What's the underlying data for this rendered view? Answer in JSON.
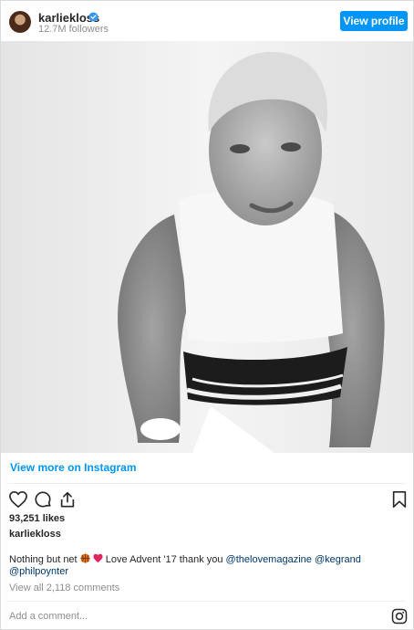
{
  "header": {
    "username": "karliekloss",
    "followers": "12.7M followers",
    "view_profile_label": "View profile",
    "verified_color": "#3897f0"
  },
  "media": {
    "description_icon": "photo",
    "tone": "black-and-white"
  },
  "links": {
    "view_more_label": "View more on Instagram"
  },
  "actions": {
    "icons": [
      "heart-icon",
      "comment-icon",
      "share-icon",
      "bookmark-icon"
    ]
  },
  "post": {
    "likes": "93,251 likes",
    "author": "karliekloss",
    "caption_text_1": "Nothing but net ",
    "caption_text_2": " Love Advent '17 thank you ",
    "mention_1": "@thelovemagazine",
    "mention_2": "@kegrand",
    "mention_3": "@philpoynter",
    "view_all_comments": "View all 2,118 comments"
  },
  "comment_box": {
    "placeholder": "Add a comment..."
  },
  "colors": {
    "accent": "#0095f6",
    "text": "#262626",
    "muted": "#8e8e8e",
    "border": "#dbdbdb"
  }
}
